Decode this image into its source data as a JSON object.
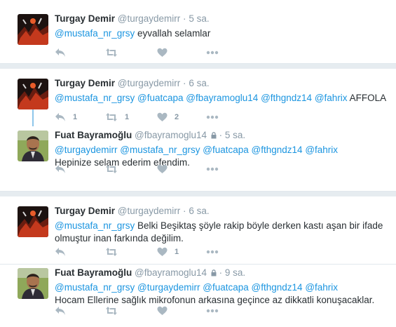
{
  "tweets": [
    {
      "name": "Turgay Demir",
      "handle": "@turgaydemirr",
      "time": "5 sa.",
      "mentions": [
        "@mustafa_nr_grsy"
      ],
      "text": "eyvallah selamlar",
      "counts": {
        "reply": "",
        "retweet": "",
        "like": ""
      }
    },
    {
      "name": "Turgay Demir",
      "handle": "@turgaydemirr",
      "time": "6 sa.",
      "mentions": [
        "@mustafa_nr_grsy",
        "@fuatcapa",
        "@fbayramoglu14",
        "@fthgndz14",
        "@fahrix"
      ],
      "text": "AFFOLA",
      "counts": {
        "reply": "1",
        "retweet": "1",
        "like": "2"
      }
    },
    {
      "name": "Fuat Bayramoğlu",
      "handle": "@fbayramoglu14",
      "time": "5 sa.",
      "protected": true,
      "mentions": [
        "@turgaydemirr",
        "@mustafa_nr_grsy",
        "@fuatcapa",
        "@fthgndz14",
        "@fahrix"
      ],
      "text": "Hepinize selam ederim efendim.",
      "counts": {
        "reply": "",
        "retweet": "",
        "like": ""
      }
    },
    {
      "name": "Turgay Demir",
      "handle": "@turgaydemirr",
      "time": "6 sa.",
      "mentions": [
        "@mustafa_nr_grsy"
      ],
      "text": "Belki Beşiktaş şöyle rakip böyle derken kastı aşan bir ifade olmuştur inan farkında değilim.",
      "counts": {
        "reply": "",
        "retweet": "",
        "like": "1"
      }
    },
    {
      "name": "Fuat Bayramoğlu",
      "handle": "@fbayramoglu14",
      "time": "9 sa.",
      "protected": true,
      "mentions": [
        "@mustafa_nr_grsy",
        "@turgaydemirr",
        "@fuatcapa",
        "@fthgndz14",
        "@fahrix"
      ],
      "text": "Hocam Ellerine sağlık mikrofonun arkasına geçince az dikkatli konuşacaklar.",
      "counts": {
        "reply": "",
        "retweet": "",
        "like": ""
      }
    }
  ],
  "separator": "·",
  "icons": {
    "reply": "reply-icon",
    "retweet": "retweet-icon",
    "like": "heart-icon",
    "more": "more-icon",
    "lock": "lock-icon"
  },
  "colors": {
    "mention": "#1b95e0",
    "thread_line": "#8ec6ea",
    "background": "#e6ecf0",
    "muted": "#8899a6"
  }
}
